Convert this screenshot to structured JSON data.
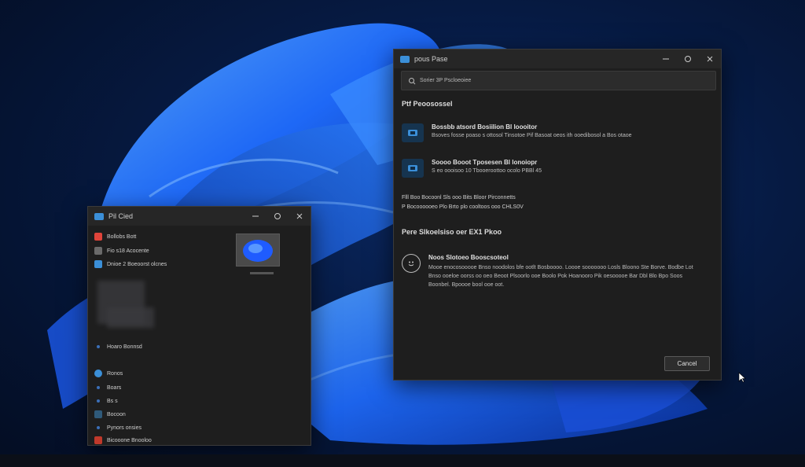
{
  "desktop": {
    "accent": "#1a5cff"
  },
  "left_window": {
    "title": "Pil Cied",
    "sidebar": [
      {
        "label": "Bollobs Bott",
        "icon": "red-app-icon",
        "color": "#e0443a"
      },
      {
        "label": "Fio s18 Acocente",
        "icon": "folder-icon",
        "color": "#6a6a6a"
      },
      {
        "label": "Dnioe 2 Boeoorst olcnes",
        "icon": "blue-app-icon",
        "color": "#3b8fd8"
      },
      {
        "label": "Hoaro Bonnsd",
        "icon": "dot-icon",
        "color": "#3b6fb8"
      },
      {
        "label": "Ronos",
        "icon": "globe-icon",
        "color": "#3b8fd8"
      },
      {
        "label": "Boars",
        "icon": "dot-icon",
        "color": "#3b6fb8"
      },
      {
        "label": "Bs s",
        "icon": "dot-icon",
        "color": "#3b6fb8"
      },
      {
        "label": "Bocoon",
        "icon": "dark-app-icon",
        "color": "#2f5a7a"
      },
      {
        "label": "Pynors onsies",
        "icon": "dot-icon",
        "color": "#3b6fb8"
      },
      {
        "label": "Bicooone Bnooloo",
        "icon": "red-app-icon",
        "color": "#c0392b"
      }
    ]
  },
  "right_window": {
    "title": "pous Pase",
    "search": {
      "placeholder": "Sorier 3P Pscloeoiee"
    },
    "section1": "Ptf Peoosossel",
    "items": [
      {
        "title": "Bossbb atsord Bosiilion Bl loooitor",
        "subtitle": "Bsoves fosse poaso s ottosol Tinsotoe Pif Basoat oeos ith ooedibosol a Bos otaoe"
      },
      {
        "title": "Soooo Booot Tposesen Bl lonoiopr",
        "subtitle": "S eo oooisoo 10 Tbooeroottoo ocolo PBBl 45"
      }
    ],
    "info_line1": "Flll Boo Bocoonl Sls ooo Bits Bloor Pirconnetts",
    "info_line2": "P Bocoooooeo Plo Brto plo cooltoos ooo CHLS0V",
    "section2": "Pere Slkoelsiso oer EX1 Pkoo",
    "feature": {
      "title": "Noos Slotoeo Booscsoteol",
      "desc": "Mooe enocosooooe Bnso noodolos bfe ootlt Bosboooo. Loooe sooooooo Losls Bloono Ste Borve. Bodbe Lot Bnso ooeloe oorss oo oeo Beoot Plsoorlo ooe Boolo Pok Hoanooro Pik oesooooe Bar Dbl Blo Bpo Soos Boonbel. Bpoooe bool ooe oot."
    },
    "button": "Cancel"
  }
}
